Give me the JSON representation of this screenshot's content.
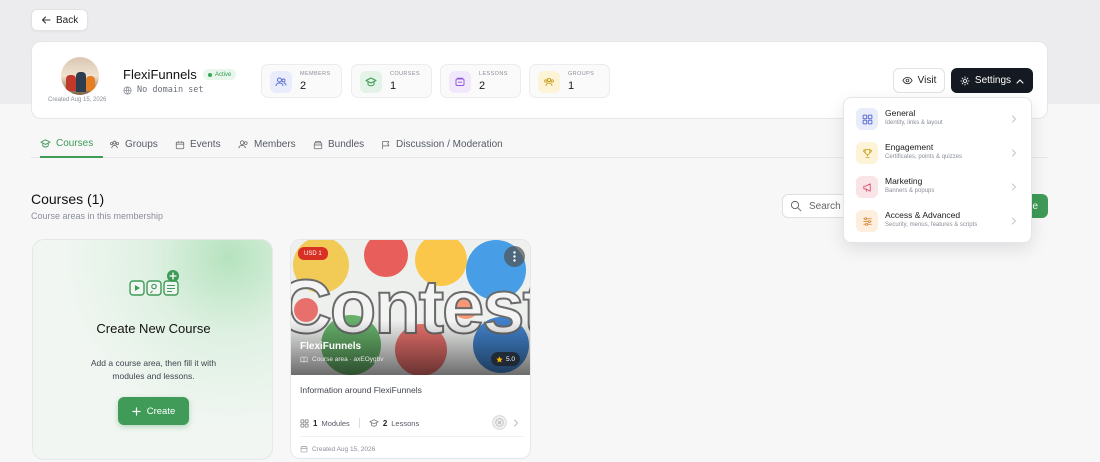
{
  "back_label": "Back",
  "header": {
    "created": "Created Aug 15, 2026",
    "name": "FlexiFunnels",
    "status": "Active",
    "domain": "No domain set",
    "stats": [
      {
        "label": "MEMBERS",
        "value": "2"
      },
      {
        "label": "COURSES",
        "value": "1"
      },
      {
        "label": "LESSONS",
        "value": "2"
      },
      {
        "label": "GROUPS",
        "value": "1"
      }
    ],
    "visit_label": "Visit",
    "settings_label": "Settings"
  },
  "tabs": [
    "Courses",
    "Groups",
    "Events",
    "Members",
    "Bundles",
    "Discussion / Moderation"
  ],
  "section": {
    "title": "Courses (1)",
    "subtitle": "Course areas in this membership",
    "search_placeholder": "Search b",
    "add_button_label": "e"
  },
  "create_card": {
    "title": "Create New Course",
    "description": "Add a course area, then fill it with modules and lessons.",
    "button_label": "Create"
  },
  "course": {
    "price": "USD 1",
    "cover_word": "Contest",
    "title": "FlexiFunnels",
    "subtitle": "Course area · axEOygbv",
    "rating": "5.0",
    "description": "Information around FlexiFunnels",
    "modules_count": "1",
    "modules_label": "Modules",
    "lessons_count": "2",
    "lessons_label": "Lessons",
    "created": "Created Aug 15, 2026"
  },
  "settings_menu": [
    {
      "title": "General",
      "subtitle": "Identity, links & layout",
      "color": "#e8ecfb",
      "icon_color": "#5b6fd6"
    },
    {
      "title": "Engagement",
      "subtitle": "Certificates, points & quizzes",
      "color": "#fdf3d6",
      "icon_color": "#c99a16"
    },
    {
      "title": "Marketing",
      "subtitle": "Banners & popups",
      "color": "#fbe4e8",
      "icon_color": "#d6455f"
    },
    {
      "title": "Access & Advanced",
      "subtitle": "Security, menus, features & scripts",
      "color": "#fdeede",
      "icon_color": "#d9822b"
    }
  ],
  "colors": {
    "accent": "#3f9b57",
    "dark": "#151a22",
    "price_badge": "#d93025"
  }
}
